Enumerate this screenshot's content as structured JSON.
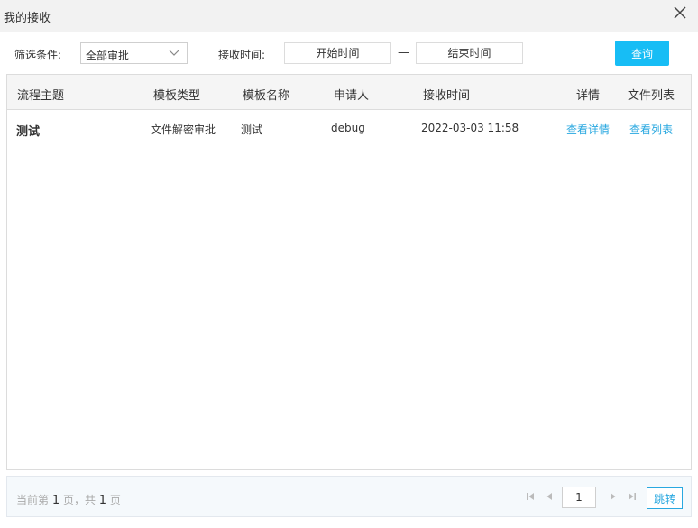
{
  "window": {
    "title": "我的接收"
  },
  "filters": {
    "condition_label": "筛选条件:",
    "condition_value": "全部审批",
    "time_label": "接收时间:",
    "start_placeholder": "开始时间",
    "end_placeholder": "结束时间",
    "separator": "—",
    "query_label": "查询"
  },
  "table": {
    "columns": [
      "流程主题",
      "模板类型",
      "模板名称",
      "申请人",
      "接收时间",
      "详情",
      "文件列表"
    ],
    "rows": [
      {
        "subject": "测试",
        "template_type": "文件解密审批",
        "template_name": "测试",
        "applicant": "debug",
        "received_time": "2022-03-03 11:58",
        "detail_link": "查看详情",
        "files_link": "查看列表"
      }
    ]
  },
  "pagination": {
    "prefix": "当前第",
    "current": "1",
    "mid": "页，共",
    "total": "1",
    "suffix": "页",
    "page_input": "1",
    "jump_label": "跳转"
  },
  "colors": {
    "accent": "#17bdf5",
    "link": "#29a8e0"
  },
  "icons": [
    "close-icon",
    "chevron-down-icon",
    "first-page-icon",
    "prev-page-icon",
    "next-page-icon",
    "last-page-icon"
  ]
}
